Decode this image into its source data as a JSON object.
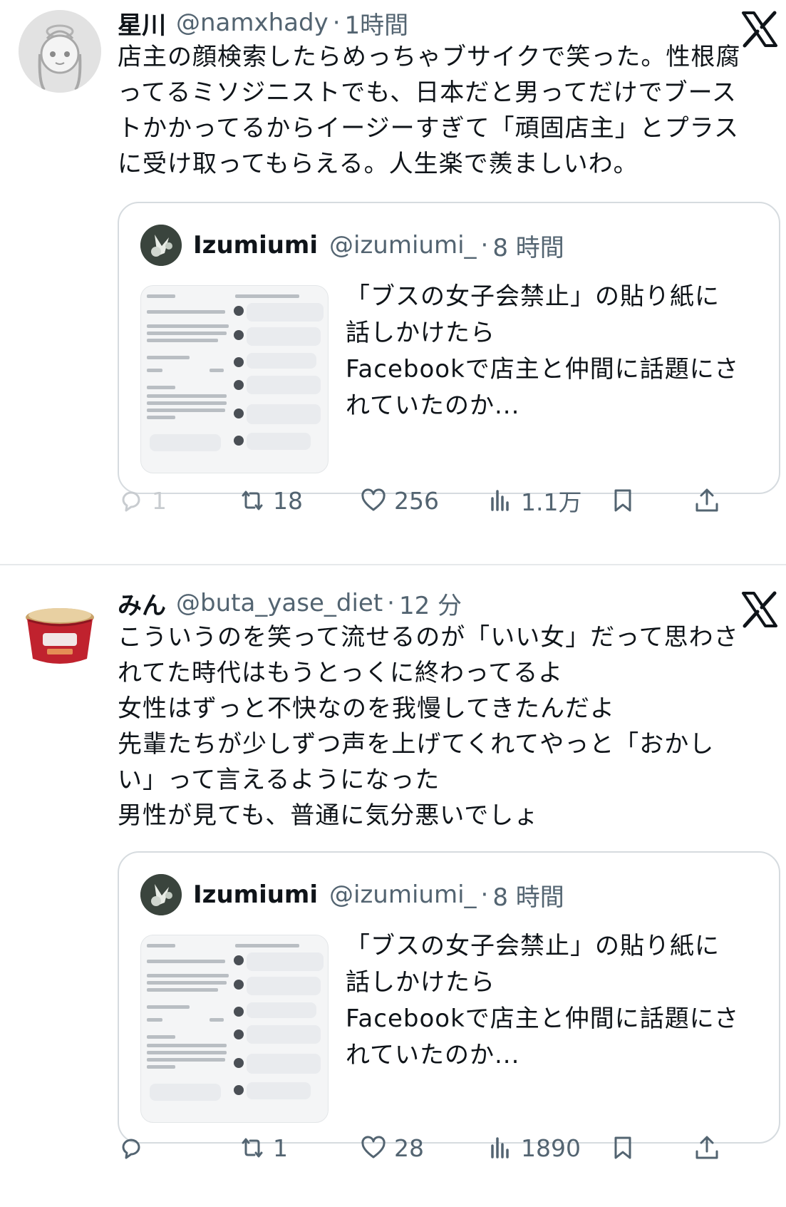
{
  "tweets": [
    {
      "user_name": "星川",
      "handle": "@namxhady",
      "time": "1時間",
      "text": "店主の顔検索したらめっちゃブサイクで笑った。性根腐\nってるミソジニストでも、日本だと男ってだけでブース\nトかかってるからイージーすぎて「頑固店主」とプラス\nに受け取ってもらえる。人生楽で羨ましいわ。",
      "quote": {
        "user_name": "Izumiumi",
        "handle": "@izumiumi_",
        "time": "8 時間",
        "text": "「ブスの女子会禁止」の貼り紙に\n話しかけたら\nFacebookで店主と仲間に話題にさ\nれていたのか..."
      },
      "actions": {
        "replies": "1",
        "retweets": "18",
        "likes": "256",
        "views": "1.1万"
      }
    },
    {
      "user_name": "みん",
      "handle": "@buta_yase_diet",
      "time": "12 分",
      "text": "こういうのを笑って流せるのが「いい女」だって思わさ\nれてた時代はもうとっくに終わってるよ\n女性はずっと不快なのを我慢してきたんだよ\n先輩たちが少しずつ声を上げてくれてやっと「おかし\nい」って言えるようになった\n男性が見ても、普通に気分悪いでしょ",
      "quote": {
        "user_name": "Izumiumi",
        "handle": "@izumiumi_",
        "time": "8 時間",
        "text": "「ブスの女子会禁止」の貼り紙に\n話しかけたら\nFacebookで店主と仲間に話題にさ\nれていたのか..."
      },
      "actions": {
        "replies": "",
        "retweets": "1",
        "likes": "28",
        "views": "1890"
      }
    }
  ],
  "colors": {
    "text": "#0f1419",
    "muted": "#536471",
    "border": "#d6dbdf"
  }
}
